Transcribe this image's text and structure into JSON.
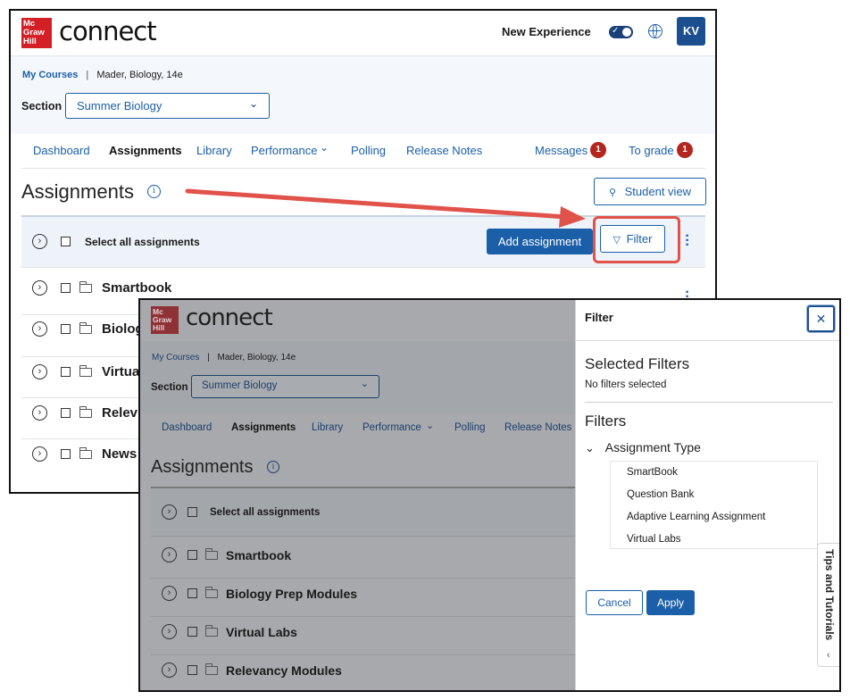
{
  "brand": {
    "logo_lines": [
      "Mc",
      "Graw",
      "Hill"
    ],
    "wordmark": "connect",
    "logo_color": "#d32027"
  },
  "header": {
    "new_experience_label": "New Experience",
    "avatar_initials": "KV"
  },
  "breadcrumb": {
    "my_courses": "My Courses",
    "separator": "|",
    "course": "Mader, Biology, 14e"
  },
  "section": {
    "label": "Section",
    "value": "Summer Biology"
  },
  "nav": {
    "dashboard": "Dashboard",
    "assignments": "Assignments",
    "library": "Library",
    "performance": "Performance",
    "polling": "Polling",
    "release_notes": "Release Notes",
    "messages": "Messages",
    "messages_count": "1",
    "to_grade": "To grade",
    "to_grade_count": "1"
  },
  "page": {
    "title": "Assignments",
    "info_icon": "info-icon",
    "student_view": "Student view"
  },
  "toolbar": {
    "select_all": "Select all assignments",
    "add_assignment": "Add assignment",
    "filter": "Filter"
  },
  "back_rows": [
    "Smartbook",
    "Biolog",
    "Virtua",
    "Relev",
    "News"
  ],
  "front_rows": [
    "Smartbook",
    "Biology Prep Modules",
    "Virtual Labs",
    "Relevancy Modules"
  ],
  "filter_panel": {
    "title": "Filter",
    "selected_heading": "Selected Filters",
    "selected_empty": "No filters selected",
    "filters_heading": "Filters",
    "group_label": "Assignment Type",
    "options": [
      "SmartBook",
      "Question Bank",
      "Adaptive Learning Assignment",
      "Virtual Labs"
    ],
    "cancel": "Cancel",
    "apply": "Apply",
    "close_icon": "close-icon"
  },
  "tips": {
    "label": "Tips and Tutorials"
  },
  "colors": {
    "primary": "#1b5fa8",
    "badge": "#b3261e",
    "annotation": "#e0524a"
  }
}
